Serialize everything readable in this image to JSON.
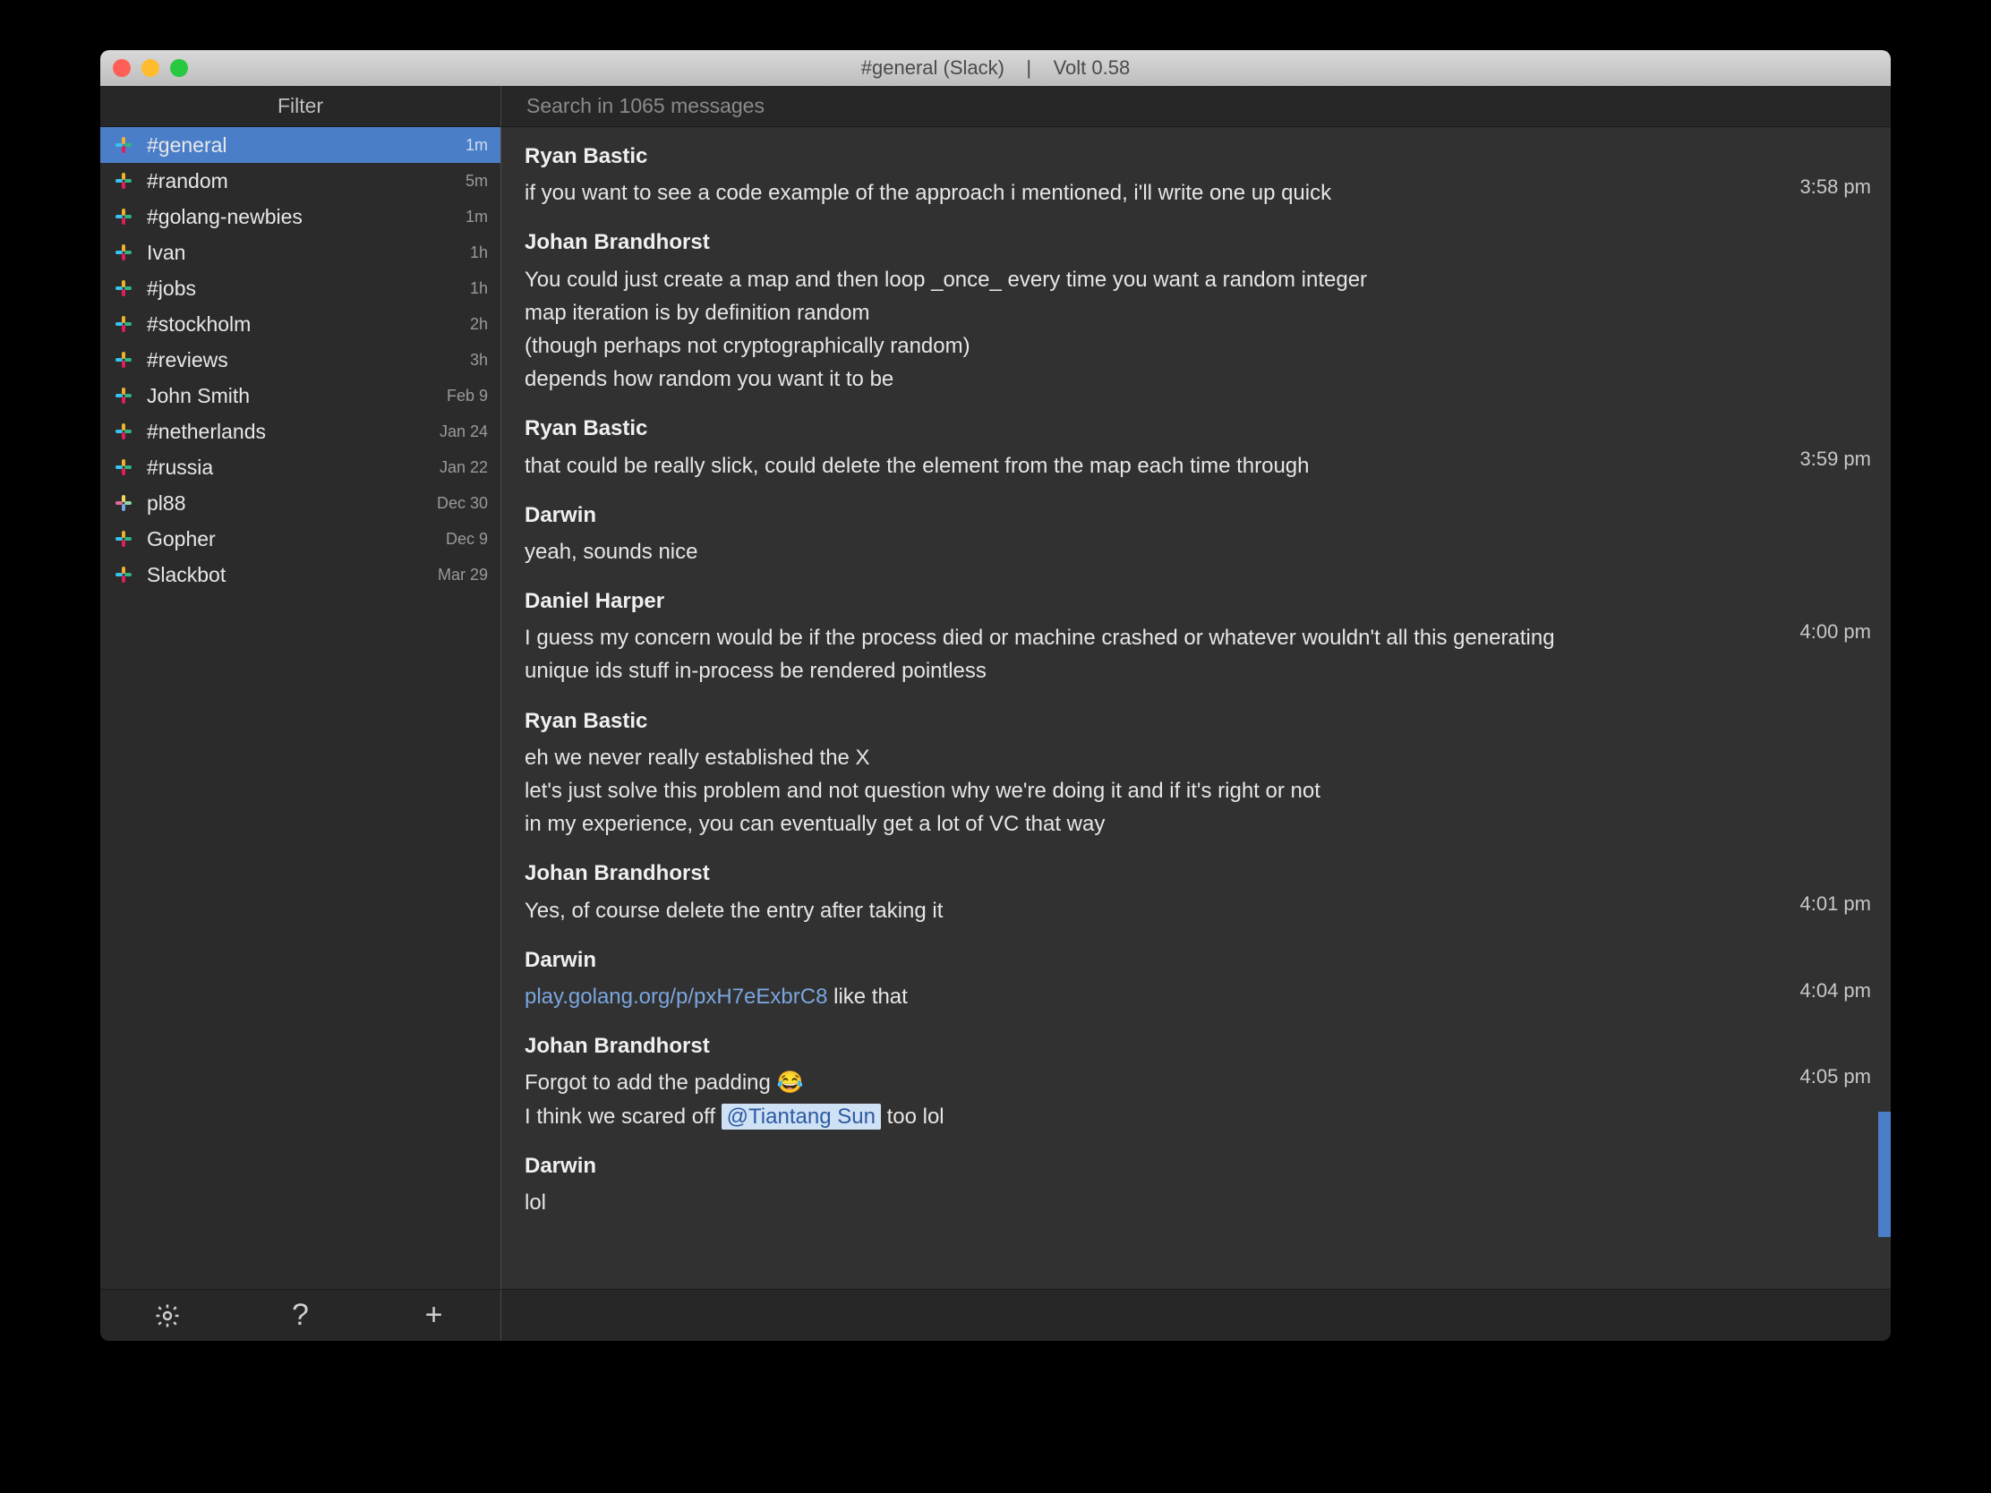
{
  "window": {
    "title": "#general (Slack)    |    Volt 0.58"
  },
  "toolbar": {
    "filter_placeholder": "Filter",
    "search_placeholder": "Search in 1065 messages"
  },
  "sidebar": {
    "channels": [
      {
        "name": "#general",
        "time": "1m",
        "selected": true,
        "icon": "slack"
      },
      {
        "name": "#random",
        "time": "5m",
        "selected": false,
        "icon": "slack"
      },
      {
        "name": "#golang-newbies",
        "time": "1m",
        "selected": false,
        "icon": "slack"
      },
      {
        "name": "Ivan",
        "time": "1h",
        "selected": false,
        "icon": "slack"
      },
      {
        "name": "#jobs",
        "time": "1h",
        "selected": false,
        "icon": "slack"
      },
      {
        "name": "#stockholm",
        "time": "2h",
        "selected": false,
        "icon": "slack"
      },
      {
        "name": "#reviews",
        "time": "3h",
        "selected": false,
        "icon": "slack"
      },
      {
        "name": "John Smith",
        "time": "Feb 9",
        "selected": false,
        "icon": "slack"
      },
      {
        "name": "#netherlands",
        "time": "Jan 24",
        "selected": false,
        "icon": "slack"
      },
      {
        "name": "#russia",
        "time": "Jan 22",
        "selected": false,
        "icon": "slack"
      },
      {
        "name": "pl88",
        "time": "Dec 30",
        "selected": false,
        "icon": "user"
      },
      {
        "name": "Gopher",
        "time": "Dec 9",
        "selected": false,
        "icon": "slack"
      },
      {
        "name": "Slackbot",
        "time": "Mar 29",
        "selected": false,
        "icon": "slack"
      }
    ]
  },
  "messages": [
    {
      "author": "Ryan Bastic",
      "time": "3:58 pm",
      "lines": [
        {
          "text": "if you want to see a code example of the approach i mentioned, i'll write one up quick"
        }
      ]
    },
    {
      "author": "Johan Brandhorst",
      "time": "",
      "lines": [
        {
          "text": "You could just create a map and then loop _once_ every time you want a random integer"
        },
        {
          "text": "map iteration is by definition random"
        },
        {
          "text": "(though perhaps not cryptographically random)"
        },
        {
          "text": "depends how random you want it to be"
        }
      ]
    },
    {
      "author": "Ryan Bastic",
      "time": "3:59 pm",
      "lines": [
        {
          "text": "that could be really slick, could delete the element from the map each time through"
        }
      ]
    },
    {
      "author": "Darwin",
      "time": "",
      "lines": [
        {
          "text": "yeah, sounds nice"
        }
      ]
    },
    {
      "author": "Daniel Harper",
      "time": "4:00 pm",
      "lines": [
        {
          "text": "I guess my concern would be if the process died or machine crashed or whatever wouldn't all this generating unique ids stuff in-process be rendered pointless"
        }
      ]
    },
    {
      "author": "Ryan Bastic",
      "time": "",
      "lines": [
        {
          "text": "eh we never really established the X"
        },
        {
          "text": "let's just solve this problem and not question why we're doing it and if it's right or not"
        },
        {
          "text": "in my experience, you can eventually get a lot of VC that way"
        }
      ]
    },
    {
      "author": "Johan Brandhorst",
      "time": "4:01 pm",
      "lines": [
        {
          "text": "Yes, of course delete the entry after taking it"
        }
      ]
    },
    {
      "author": "Darwin",
      "time": "4:04 pm",
      "lines": [
        {
          "link": "play.golang.org/p/pxH7eExbrC8",
          "text_after": "  like that"
        }
      ]
    },
    {
      "author": "Johan Brandhorst",
      "time": "4:05 pm",
      "lines": [
        {
          "text": "Forgot to add the padding 😂"
        },
        {
          "text_before": "I think we scared off ",
          "mention": "@Tiantang Sun",
          "text_after": "   too lol"
        }
      ]
    },
    {
      "author": "Darwin",
      "time": "",
      "lines": [
        {
          "text": "lol"
        }
      ]
    }
  ],
  "footer": {
    "help_label": "?",
    "add_label": "+"
  }
}
